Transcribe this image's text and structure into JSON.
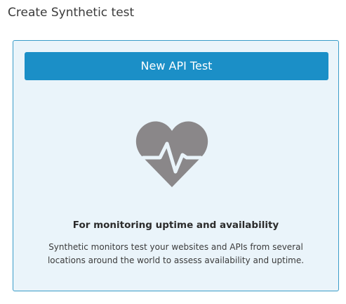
{
  "page": {
    "title": "Create Synthetic test"
  },
  "card": {
    "button_label": "New API Test",
    "illustration_icon": "heart-pulse-icon",
    "headline": "For monitoring uptime and availability",
    "description": "Synthetic monitors test your websites and APIs from several locations around the world to assess availability and uptime."
  },
  "colors": {
    "accent": "#1b8fc7",
    "card_border": "#3a9cc8",
    "card_background": "#eaf4fa",
    "icon_gray": "#8a8789"
  }
}
